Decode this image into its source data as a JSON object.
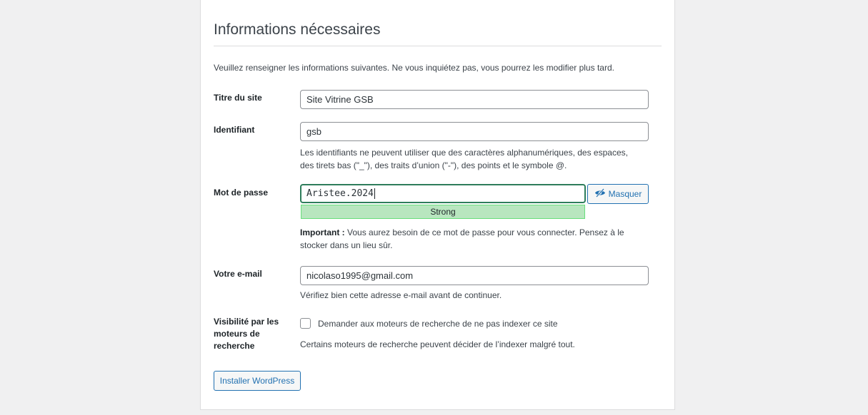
{
  "section": {
    "heading": "Informations nécessaires",
    "intro": "Veuillez renseigner les informations suivantes. Ne vous inquiétez pas, vous pourrez les modifier plus tard."
  },
  "site_title": {
    "label": "Titre du site",
    "value": "Site Vitrine GSB"
  },
  "username": {
    "label": "Identifiant",
    "value": "gsb",
    "help_line1": "Les identifiants ne peuvent utiliser que des caractères alphanumériques, des espaces,",
    "help_line2": "des tirets bas (\"_\"), des traits d’union (\"-\"), des points et le symbole @."
  },
  "password": {
    "label": "Mot de passe",
    "value": "Aristee.2024",
    "toggle_label": "Masquer",
    "strength_label": "Strong",
    "important_prefix": "Important :",
    "important_text": " Vous aurez besoin de ce mot de passe pour vous connecter. Pensez à le",
    "important_text2": "stocker dans un lieu sûr."
  },
  "email": {
    "label": "Votre e-mail",
    "value": "nicolaso1995@gmail.com",
    "help": "Vérifiez bien cette adresse e-mail avant de continuer."
  },
  "visibility": {
    "label_line1": "Visibilité par les",
    "label_line2": "moteurs de",
    "label_line3": "recherche",
    "checkbox_label": "Demander aux moteurs de recherche de ne pas indexer ce site",
    "checked": false,
    "help": "Certains moteurs de recherche peuvent décider de l’indexer malgré tout."
  },
  "actions": {
    "install_label": "Installer WordPress"
  },
  "colors": {
    "accent": "#2271b1",
    "strength_bg": "#b8e6bf",
    "focus_border": "#2e7d5b"
  },
  "icons": {
    "toggle": "eye-slash-icon"
  }
}
